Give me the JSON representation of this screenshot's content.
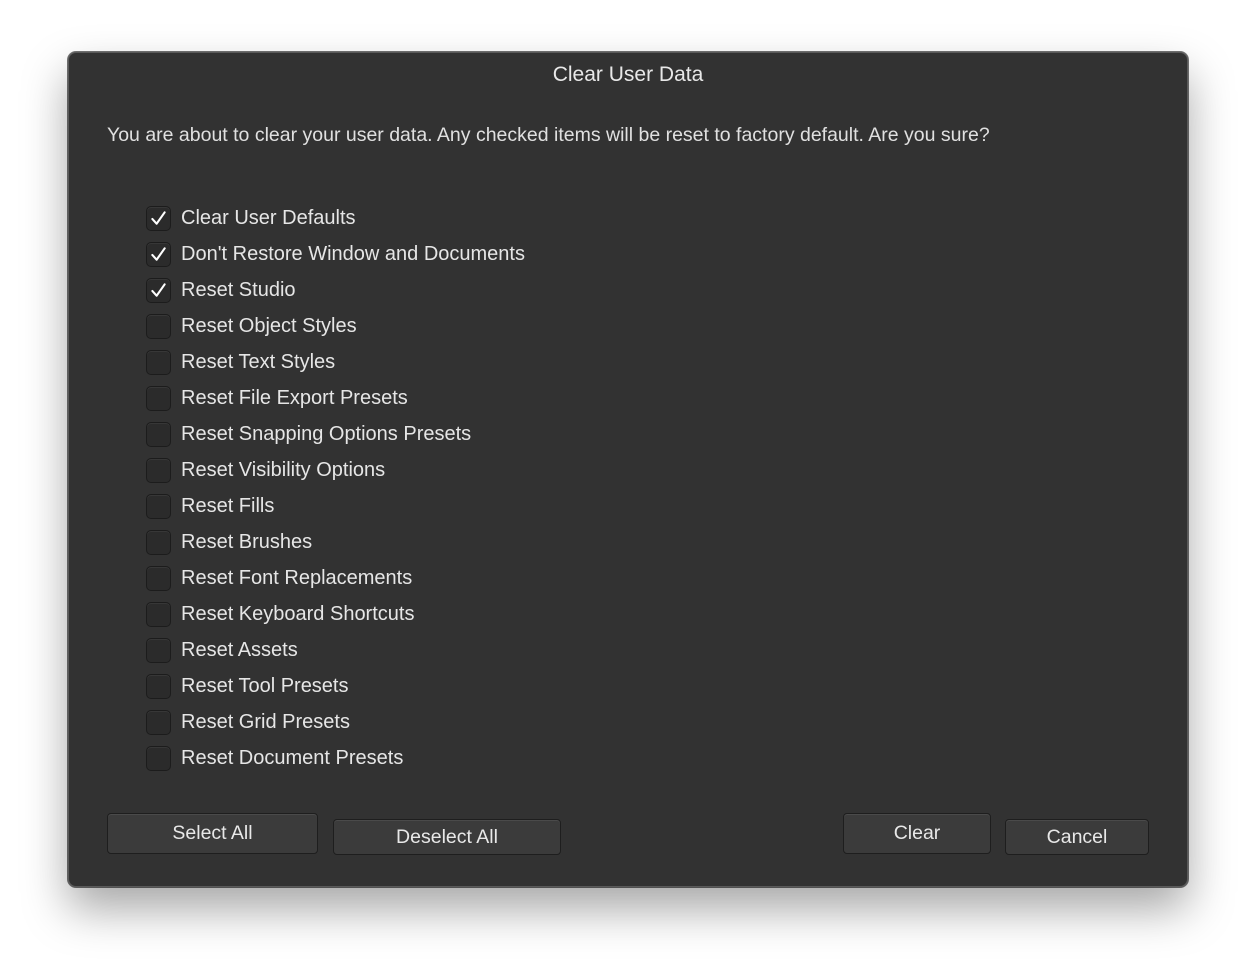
{
  "dialog": {
    "title": "Clear User Data",
    "message": "You are about to clear your user data. Any checked items will be reset to factory default. Are you sure?"
  },
  "options": [
    {
      "label": "Clear User Defaults",
      "checked": true
    },
    {
      "label": "Don't Restore Window and Documents",
      "checked": true
    },
    {
      "label": "Reset Studio",
      "checked": true
    },
    {
      "label": "Reset Object Styles",
      "checked": false
    },
    {
      "label": "Reset Text Styles",
      "checked": false
    },
    {
      "label": "Reset File Export Presets",
      "checked": false
    },
    {
      "label": "Reset Snapping Options Presets",
      "checked": false
    },
    {
      "label": "Reset Visibility Options",
      "checked": false
    },
    {
      "label": "Reset Fills",
      "checked": false
    },
    {
      "label": "Reset Brushes",
      "checked": false
    },
    {
      "label": "Reset Font Replacements",
      "checked": false
    },
    {
      "label": "Reset Keyboard Shortcuts",
      "checked": false
    },
    {
      "label": "Reset Assets",
      "checked": false
    },
    {
      "label": "Reset Tool Presets",
      "checked": false
    },
    {
      "label": "Reset Grid Presets",
      "checked": false
    },
    {
      "label": "Reset Document Presets",
      "checked": false
    }
  ],
  "buttons": {
    "select_all": "Select All",
    "deselect_all": "Deselect All",
    "clear": "Clear",
    "cancel": "Cancel"
  },
  "icons": {
    "checkbox_checked": "checkmark-icon"
  },
  "colors": {
    "dialog_background": "#323232",
    "text": "#e6e6e6",
    "button_background": "#3b3b3b"
  }
}
